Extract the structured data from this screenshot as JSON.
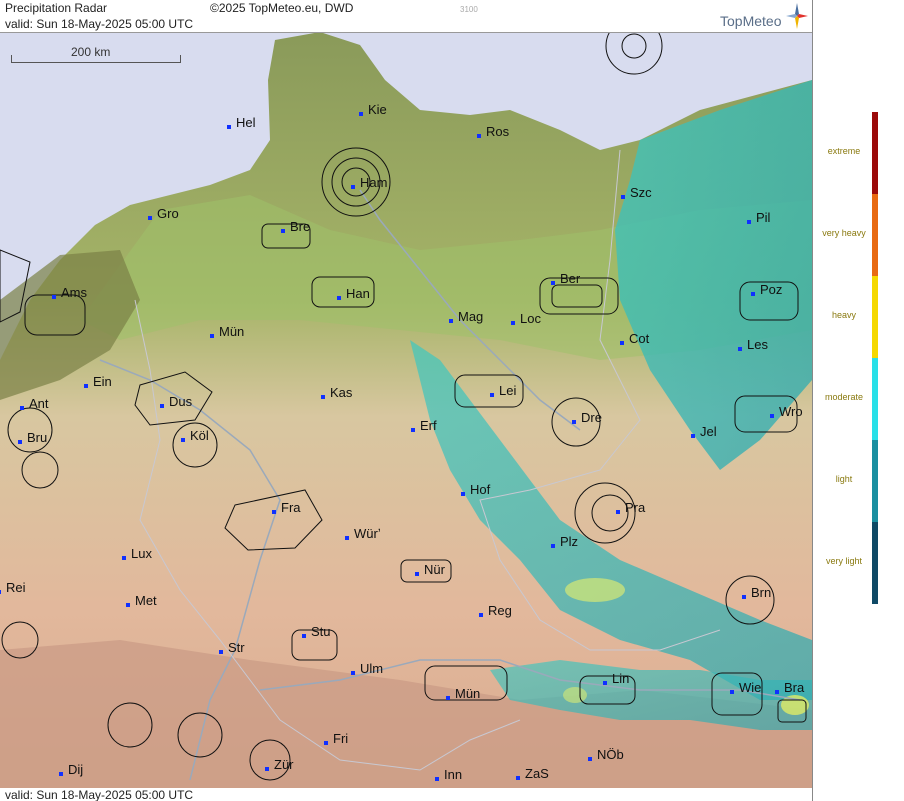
{
  "header": {
    "title": "Precipitation Radar",
    "copyright": "©2025 TopMeteo.eu, DWD",
    "code": "3100",
    "valid": "valid:  Sun  18-May-2025 05:00 UTC",
    "brand": "TopMeteo"
  },
  "footer": {
    "valid": "valid:  Sun  18-May-2025 05:00 UTC"
  },
  "scale": {
    "label": "200 km"
  },
  "cities": [
    {
      "name": "Hel"
    },
    {
      "name": "Kie"
    },
    {
      "name": "Ros"
    },
    {
      "name": "Ham"
    },
    {
      "name": "Szc"
    },
    {
      "name": "Gro"
    },
    {
      "name": "Bre"
    },
    {
      "name": "Pil"
    },
    {
      "name": "Ams"
    },
    {
      "name": "Han"
    },
    {
      "name": "Ber"
    },
    {
      "name": "Poz"
    },
    {
      "name": "Mün"
    },
    {
      "name": "Mag"
    },
    {
      "name": "Loc"
    },
    {
      "name": "Cot"
    },
    {
      "name": "Les"
    },
    {
      "name": "Ein"
    },
    {
      "name": "Kas"
    },
    {
      "name": "Lei"
    },
    {
      "name": "Ant"
    },
    {
      "name": "Dus"
    },
    {
      "name": "Wro"
    },
    {
      "name": "Dre"
    },
    {
      "name": "Bru"
    },
    {
      "name": "Köl"
    },
    {
      "name": "Erf"
    },
    {
      "name": "Jel"
    },
    {
      "name": "Hof"
    },
    {
      "name": "Fra"
    },
    {
      "name": "Pra"
    },
    {
      "name": "Würʼ"
    },
    {
      "name": "Plz"
    },
    {
      "name": "Lux"
    },
    {
      "name": "Nür"
    },
    {
      "name": "Rei"
    },
    {
      "name": "Met"
    },
    {
      "name": "Brn"
    },
    {
      "name": "Reg"
    },
    {
      "name": "Stu"
    },
    {
      "name": "Str"
    },
    {
      "name": "Ulm"
    },
    {
      "name": "Lin"
    },
    {
      "name": "Mün"
    },
    {
      "name": "Wie"
    },
    {
      "name": "Bra"
    },
    {
      "name": "Fri"
    },
    {
      "name": "NÖb"
    },
    {
      "name": "Dij"
    },
    {
      "name": "Zür"
    },
    {
      "name": "Inn"
    },
    {
      "name": "ZaS"
    }
  ],
  "legend": {
    "levels": [
      {
        "label": "extreme",
        "color": "#9b0a0a"
      },
      {
        "label": "very heavy",
        "color": "#e86a12"
      },
      {
        "label": "heavy",
        "color": "#f5d800"
      },
      {
        "label": "moderate",
        "color": "#28e0e8"
      },
      {
        "label": "light",
        "color": "#1a8fa0"
      },
      {
        "label": "very light",
        "color": "#0f4a66"
      }
    ]
  }
}
